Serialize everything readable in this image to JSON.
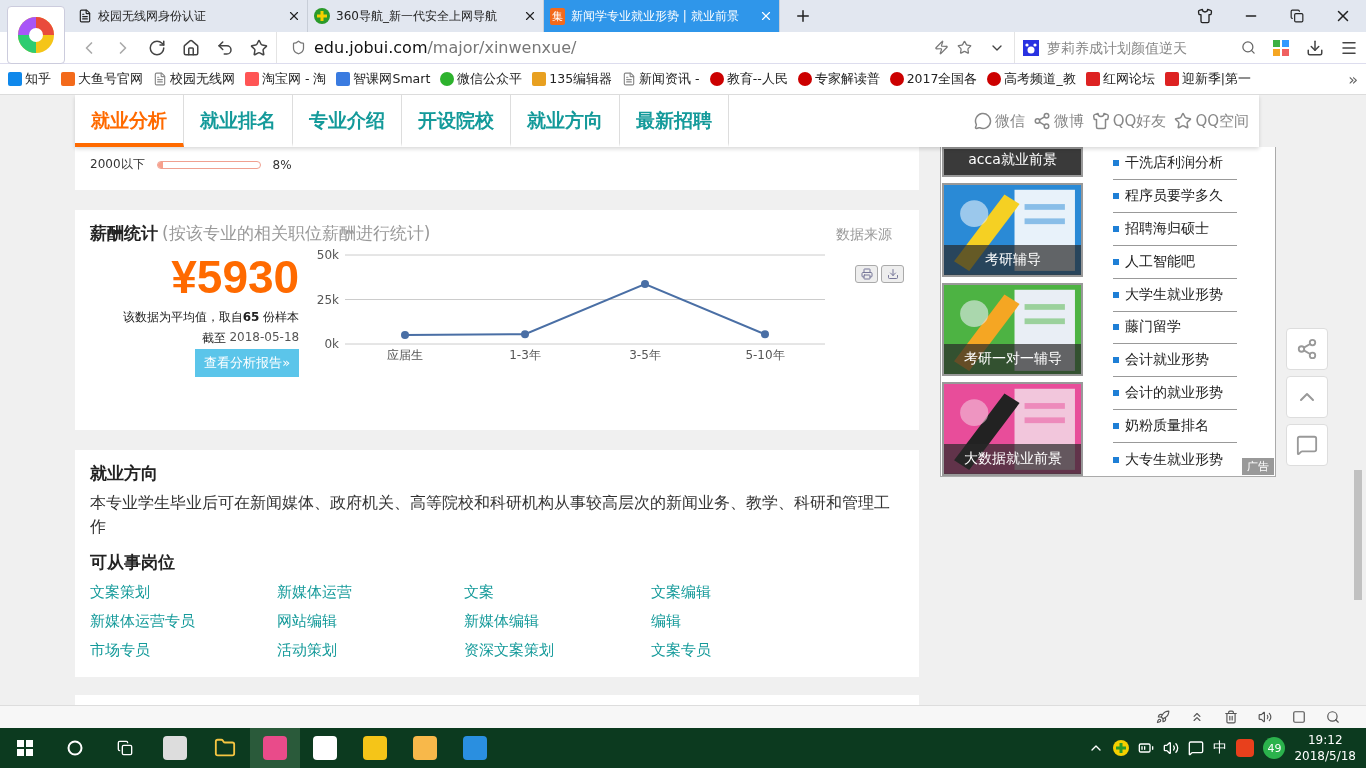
{
  "browser": {
    "tabs": [
      {
        "title": "校园无线网身份认证",
        "selected": false
      },
      {
        "title": "360导航_新一代安全上网导航",
        "selected": false
      },
      {
        "title": "新闻学专业就业形势 | 就业前景",
        "badge": "集",
        "selected": true
      }
    ],
    "address": {
      "host": "edu.jobui.com",
      "path": "/major/xinwenxue/"
    },
    "search": {
      "placeholder": "萝莉养成计划颜值逆天"
    },
    "bookmarks": [
      "知乎",
      "大鱼号官网",
      "校园无线网",
      "淘宝网 - 淘",
      "智课网Smart",
      "微信公众平",
      "135编辑器",
      "新闻资讯 -",
      "教育--人民",
      "专家解读普",
      "2017全国各",
      "高考频道_教",
      "红网论坛",
      "迎新季|第一"
    ],
    "more": "»"
  },
  "nav": {
    "tabs": [
      {
        "label": "就业分析",
        "selected": true
      },
      {
        "label": "就业排名",
        "selected": false
      },
      {
        "label": "专业介绍",
        "selected": false
      },
      {
        "label": "开设院校",
        "selected": false
      },
      {
        "label": "就业方向",
        "selected": false
      },
      {
        "label": "最新招聘",
        "selected": false
      }
    ],
    "share": [
      "微信",
      "微博",
      "QQ好友",
      "QQ空间"
    ]
  },
  "distribution": {
    "label": "2000以下",
    "level": 0.05,
    "value": "8%"
  },
  "salary": {
    "title": "薪酬统计",
    "subtitle": "(按该专业的相关职位薪酬进行统计)",
    "source": "数据来源",
    "amount": "¥5930",
    "note": "该数据为平均值，取自**65** 份样本",
    "date_label": "截至",
    "date": "2018-05-18",
    "button": "查看分析报告»",
    "chart_data": {
      "type": "line",
      "categories": [
        "应届生",
        "1-3年",
        "3-5年",
        "5-10年"
      ],
      "series": [
        {
          "color": "#4a6fa5",
          "marker": "circle",
          "values": [
            5000,
            5500,
            33700,
            5500
          ]
        }
      ],
      "ylim": [
        0,
        50000
      ],
      "yticks": [
        {
          "value": 0,
          "label": "0k"
        },
        {
          "value": 25000,
          "label": "25k"
        },
        {
          "value": 50000,
          "label": "50k"
        }
      ]
    }
  },
  "careers": {
    "title": "就业方向",
    "description": "本专业学生毕业后可在新闻媒体、政府机关、高等院校和科研机构从事较高层次的新闻业务、教学、科研和管理工作",
    "subtitle": "可从事岗位",
    "jobs": [
      "文案策划",
      "新媒体运营",
      "文案",
      "文案编辑",
      "新媒体运营专员",
      "网站编辑",
      "新媒体编辑",
      "编辑",
      "市场专员",
      "活动策划",
      "资深文案策划",
      "文案专员"
    ]
  },
  "side": {
    "tiles": [
      "acca就业前景",
      "考研辅导",
      "考研一对一辅导",
      "大数据就业前景"
    ],
    "links": [
      "干洗店利润分析",
      "程序员要学多久",
      "招聘海归硕士",
      "人工智能吧",
      "大学生就业形势",
      "藤门留学",
      "会计就业形势",
      "会计的就业形势",
      "奶粉质量排名",
      "大专生就业形势"
    ],
    "ad_label": "广告"
  },
  "taskbar": {
    "ime": "中",
    "badge": "49",
    "time": "19:12",
    "date": "2018/5/18"
  }
}
